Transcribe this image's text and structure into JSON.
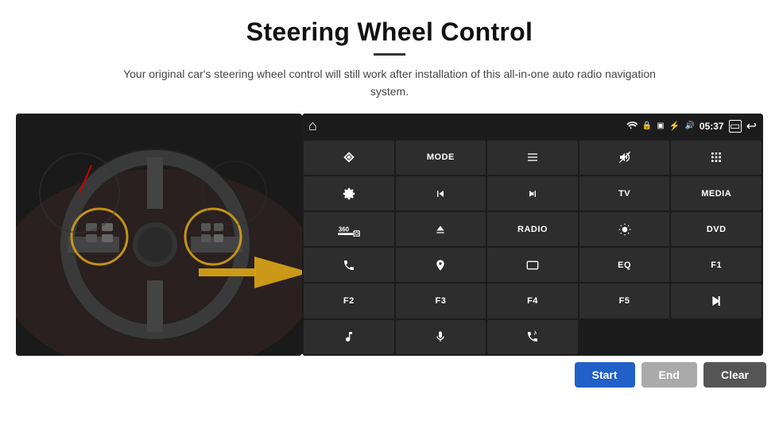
{
  "header": {
    "title": "Steering Wheel Control",
    "subtitle": "Your original car's steering wheel control will still work after installation of this all-in-one auto radio navigation system."
  },
  "status_bar": {
    "time": "05:37",
    "home_icon": "⌂",
    "wifi_icon": "wifi",
    "lock_icon": "🔒",
    "sim_icon": "sim",
    "bluetooth_icon": "bt",
    "volume_icon": "vol",
    "back_icon": "back",
    "multi_icon": "multi"
  },
  "grid_buttons": [
    {
      "id": "btn-navigate",
      "type": "icon",
      "icon": "navigate",
      "col": 1,
      "row": 1
    },
    {
      "id": "btn-mode",
      "type": "label",
      "label": "MODE",
      "col": 2,
      "row": 1
    },
    {
      "id": "btn-list",
      "type": "icon",
      "icon": "list",
      "col": 3,
      "row": 1
    },
    {
      "id": "btn-mute",
      "type": "icon",
      "icon": "mute",
      "col": 4,
      "row": 1
    },
    {
      "id": "btn-apps",
      "type": "icon",
      "icon": "apps",
      "col": 5,
      "row": 1
    },
    {
      "id": "btn-settings",
      "type": "icon",
      "icon": "settings",
      "col": 1,
      "row": 2
    },
    {
      "id": "btn-prev",
      "type": "icon",
      "icon": "prev",
      "col": 2,
      "row": 2
    },
    {
      "id": "btn-next",
      "type": "icon",
      "icon": "next",
      "col": 3,
      "row": 2
    },
    {
      "id": "btn-tv",
      "type": "label",
      "label": "TV",
      "col": 4,
      "row": 2
    },
    {
      "id": "btn-media",
      "type": "label",
      "label": "MEDIA",
      "col": 5,
      "row": 2
    },
    {
      "id": "btn-360",
      "type": "icon",
      "icon": "360cam",
      "col": 1,
      "row": 3
    },
    {
      "id": "btn-eject",
      "type": "icon",
      "icon": "eject",
      "col": 2,
      "row": 3
    },
    {
      "id": "btn-radio",
      "type": "label",
      "label": "RADIO",
      "col": 3,
      "row": 3
    },
    {
      "id": "btn-brightness",
      "type": "icon",
      "icon": "brightness",
      "col": 4,
      "row": 3
    },
    {
      "id": "btn-dvd",
      "type": "label",
      "label": "DVD",
      "col": 5,
      "row": 3
    },
    {
      "id": "btn-phone",
      "type": "icon",
      "icon": "phone",
      "col": 1,
      "row": 4
    },
    {
      "id": "btn-navi",
      "type": "icon",
      "icon": "navi",
      "col": 2,
      "row": 4
    },
    {
      "id": "btn-screen",
      "type": "icon",
      "icon": "screen",
      "col": 3,
      "row": 4
    },
    {
      "id": "btn-eq",
      "type": "label",
      "label": "EQ",
      "col": 4,
      "row": 4
    },
    {
      "id": "btn-f1",
      "type": "label",
      "label": "F1",
      "col": 5,
      "row": 4
    },
    {
      "id": "btn-f2",
      "type": "label",
      "label": "F2",
      "col": 1,
      "row": 5
    },
    {
      "id": "btn-f3",
      "type": "label",
      "label": "F3",
      "col": 2,
      "row": 5
    },
    {
      "id": "btn-f4",
      "type": "label",
      "label": "F4",
      "col": 3,
      "row": 5
    },
    {
      "id": "btn-f5",
      "type": "label",
      "label": "F5",
      "col": 4,
      "row": 5
    },
    {
      "id": "btn-playpause",
      "type": "icon",
      "icon": "playpause",
      "col": 5,
      "row": 5
    },
    {
      "id": "btn-music",
      "type": "icon",
      "icon": "music",
      "col": 1,
      "row": 6
    },
    {
      "id": "btn-mic",
      "type": "icon",
      "icon": "mic",
      "col": 2,
      "row": 6
    },
    {
      "id": "btn-call",
      "type": "icon",
      "icon": "call",
      "col": 3,
      "row": 6
    }
  ],
  "bottom_buttons": {
    "start": "Start",
    "end": "End",
    "clear": "Clear"
  }
}
